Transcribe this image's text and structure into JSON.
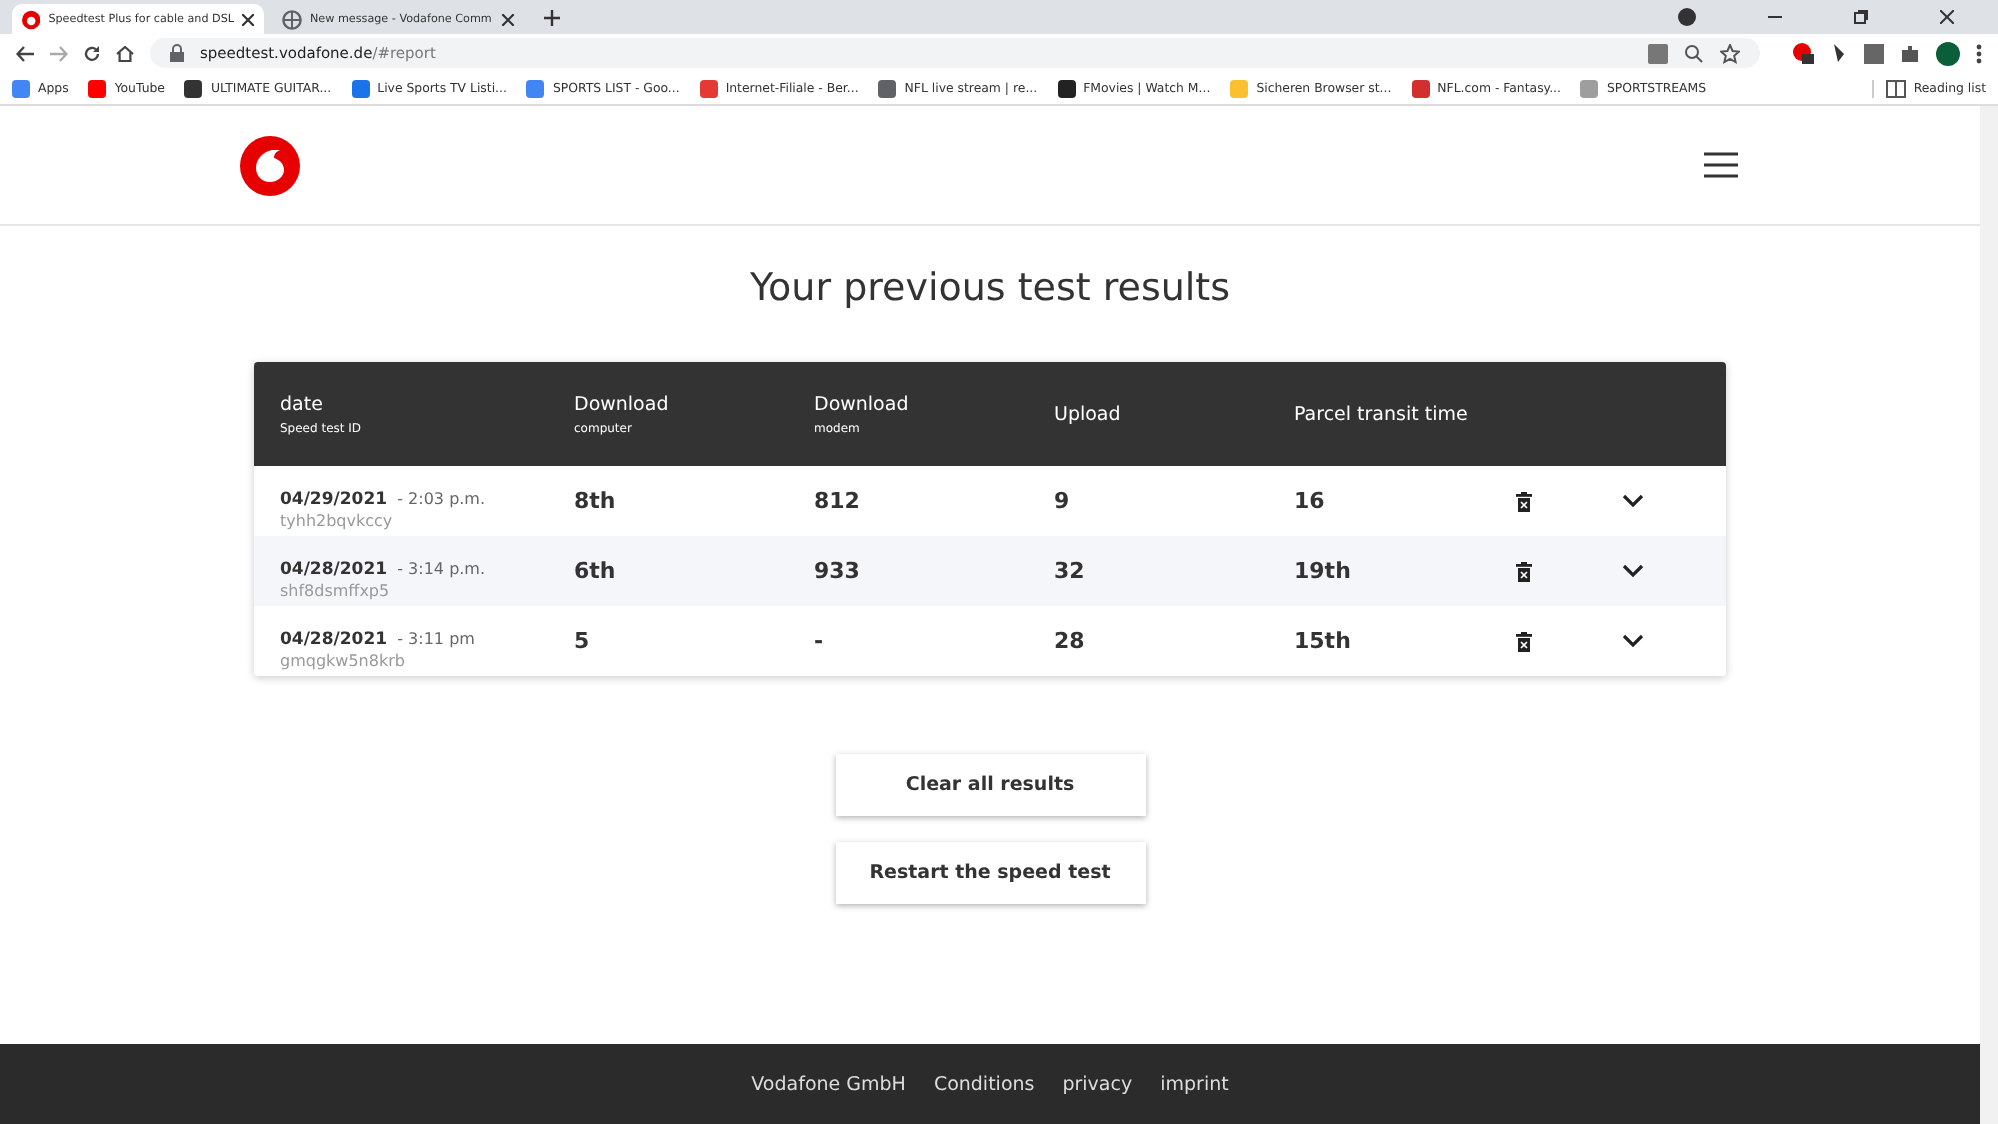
{
  "browser": {
    "tabs": [
      {
        "title": "Speedtest Plus for cable and DSL",
        "selected": true
      },
      {
        "title": "New message - Vodafone Comm",
        "selected": false
      }
    ],
    "url_host": "speedtest.vodafone.de",
    "url_path": "/#report",
    "bookmarks": [
      {
        "label": "Apps",
        "color": "#4285f4"
      },
      {
        "label": "YouTube",
        "color": "#ff0000"
      },
      {
        "label": "ULTIMATE GUITAR...",
        "color": "#333333"
      },
      {
        "label": "Live Sports TV Listi...",
        "color": "#1a73e8"
      },
      {
        "label": "SPORTS LIST - Goo...",
        "color": "#4285f4"
      },
      {
        "label": "Internet-Filiale - Ber...",
        "color": "#e53935"
      },
      {
        "label": "NFL live stream | re...",
        "color": "#5f6368"
      },
      {
        "label": "FMovies | Watch M...",
        "color": "#222222"
      },
      {
        "label": "Sicheren Browser st...",
        "color": "#fbc02d"
      },
      {
        "label": "NFL.com - Fantasy...",
        "color": "#d32f2f"
      },
      {
        "label": "SPORTSTREAMS",
        "color": "#9e9e9e"
      }
    ],
    "reading_list": "Reading list"
  },
  "page": {
    "title": "Your previous test results",
    "columns": [
      {
        "label": "date",
        "sub": "Speed test ID"
      },
      {
        "label": "Download",
        "sub": "computer"
      },
      {
        "label": "Download",
        "sub": "modem"
      },
      {
        "label": "Upload"
      },
      {
        "label": "Parcel transit time"
      }
    ],
    "rows": [
      {
        "date": "04/29/2021",
        "time": "- 2:03 p.m.",
        "id": "tyhh2bqvkccy",
        "download_computer": "8th",
        "download_modem": "812",
        "upload": "9",
        "transit": "16"
      },
      {
        "date": "04/28/2021",
        "time": "- 3:14 p.m.",
        "id": "shf8dsmffxp5",
        "download_computer": "6th",
        "download_modem": "933",
        "upload": "32",
        "transit": "19th"
      },
      {
        "date": "04/28/2021",
        "time": "- 3:11 pm",
        "id": "gmqgkw5n8krb",
        "download_computer": "5",
        "download_modem": "-",
        "upload": "28",
        "transit": "15th"
      }
    ],
    "buttons": [
      "Clear all results",
      "Restart the speed test"
    ],
    "footer": [
      "Vodafone GmbH",
      "Conditions",
      "privacy",
      "imprint"
    ]
  }
}
